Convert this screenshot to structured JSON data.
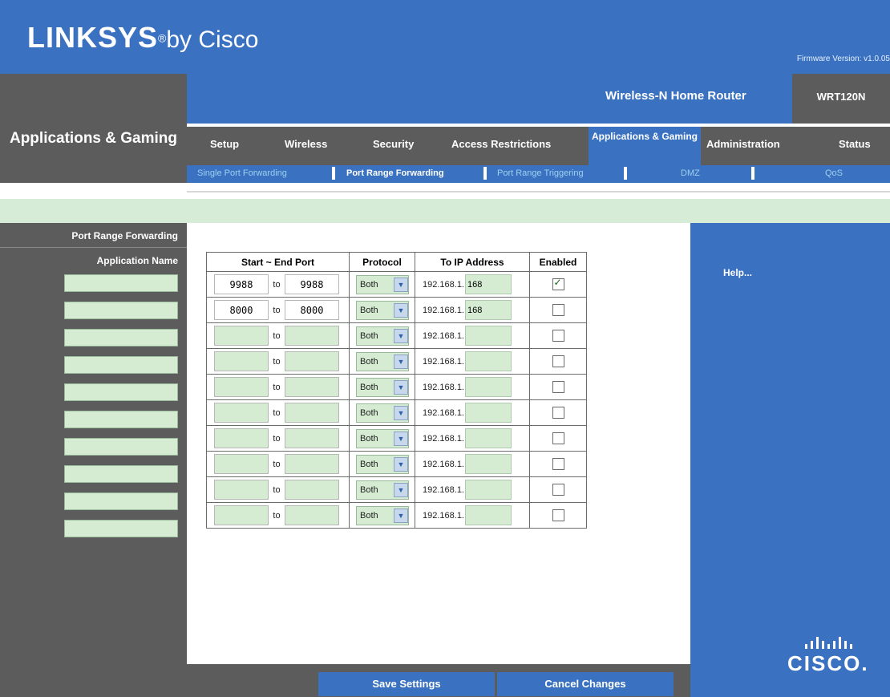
{
  "header": {
    "brand": "LINKSYS",
    "registered": "®",
    "by": "by Cisco",
    "firmware": "Firmware Version: v1.0.05",
    "product": "Wireless-N Home Router",
    "model": "WRT120N"
  },
  "section_title": "Applications & Gaming",
  "tabs": [
    {
      "label": "Setup"
    },
    {
      "label": "Wireless"
    },
    {
      "label": "Security"
    },
    {
      "label": "Access Restrictions"
    },
    {
      "label": "Applications & Gaming",
      "active": true
    },
    {
      "label": "Administration"
    },
    {
      "label": "Status"
    }
  ],
  "subnav": [
    {
      "label": "Single Port Forwarding"
    },
    {
      "label": "Port Range Forwarding",
      "current": true
    },
    {
      "label": "Port Range Triggering"
    },
    {
      "label": "DMZ"
    },
    {
      "label": "QoS"
    }
  ],
  "left": {
    "heading": "Port Range Forwarding",
    "app_name_label": "Application Name"
  },
  "table": {
    "headers": {
      "port": "Start ~ End Port",
      "protocol": "Protocol",
      "ip": "To IP Address",
      "enabled": "Enabled"
    },
    "to_label": "to",
    "ip_prefix": "192.168.1.",
    "rows": [
      {
        "app": "",
        "start": "9988",
        "end": "9988",
        "protocol": "Both",
        "ip_last": "168",
        "enabled": true
      },
      {
        "app": "",
        "start": "8000",
        "end": "8000",
        "protocol": "Both",
        "ip_last": "168",
        "enabled": false
      },
      {
        "app": "",
        "start": "",
        "end": "",
        "protocol": "Both",
        "ip_last": "",
        "enabled": false
      },
      {
        "app": "",
        "start": "",
        "end": "",
        "protocol": "Both",
        "ip_last": "",
        "enabled": false
      },
      {
        "app": "",
        "start": "",
        "end": "",
        "protocol": "Both",
        "ip_last": "",
        "enabled": false
      },
      {
        "app": "",
        "start": "",
        "end": "",
        "protocol": "Both",
        "ip_last": "",
        "enabled": false
      },
      {
        "app": "",
        "start": "",
        "end": "",
        "protocol": "Both",
        "ip_last": "",
        "enabled": false
      },
      {
        "app": "",
        "start": "",
        "end": "",
        "protocol": "Both",
        "ip_last": "",
        "enabled": false
      },
      {
        "app": "",
        "start": "",
        "end": "",
        "protocol": "Both",
        "ip_last": "",
        "enabled": false
      },
      {
        "app": "",
        "start": "",
        "end": "",
        "protocol": "Both",
        "ip_last": "",
        "enabled": false
      }
    ]
  },
  "help": {
    "label": "Help...",
    "logo_text": "CISCO."
  },
  "footer": {
    "save": "Save Settings",
    "cancel": "Cancel Changes"
  },
  "colors": {
    "primary_blue": "#3a72c1",
    "dark_gray": "#5c5c5c",
    "input_green": "#d5ecd3"
  }
}
